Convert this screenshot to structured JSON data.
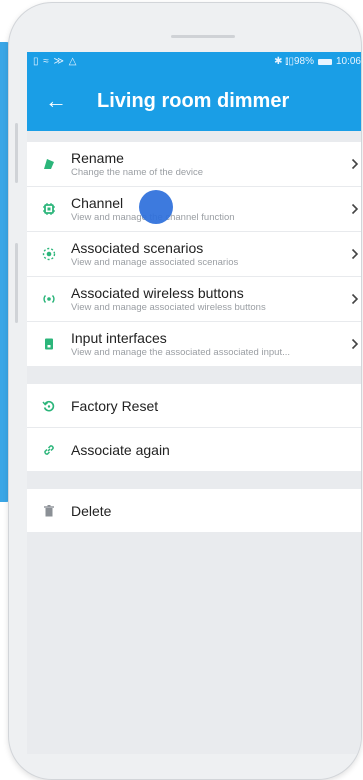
{
  "status": {
    "left_icons": "▯ ≈ ≫ △",
    "right_text": "✱ ⫾▯98%",
    "time": "10:06"
  },
  "appbar": {
    "back_icon": "arrow-left-icon",
    "title": "Living room dimmer"
  },
  "settings": [
    {
      "label": "Rename",
      "sub": "Change the name of the device",
      "icon": "tag-icon"
    },
    {
      "label": "Channel",
      "sub": "View and manage the channel function",
      "icon": "chip-icon"
    },
    {
      "label": "Associated scenarios",
      "sub": "View and manage associated scenarios",
      "icon": "scene-icon"
    },
    {
      "label": "Associated wireless buttons",
      "sub": "View and manage associated wireless buttons",
      "icon": "wireless-icon"
    },
    {
      "label": "Input interfaces",
      "sub": "View and manage the associated associated input...",
      "icon": "switch-icon"
    }
  ],
  "actions": [
    {
      "label": "Factory Reset",
      "icon": "reset-icon"
    },
    {
      "label": "Associate again",
      "icon": "link-icon"
    }
  ],
  "danger": {
    "label": "Delete",
    "icon": "trash-icon"
  },
  "colors": {
    "primary": "#1a9ee6",
    "icon": "#2bb57a",
    "delete_icon": "#8b9096",
    "touch": "#2c6fdb"
  }
}
